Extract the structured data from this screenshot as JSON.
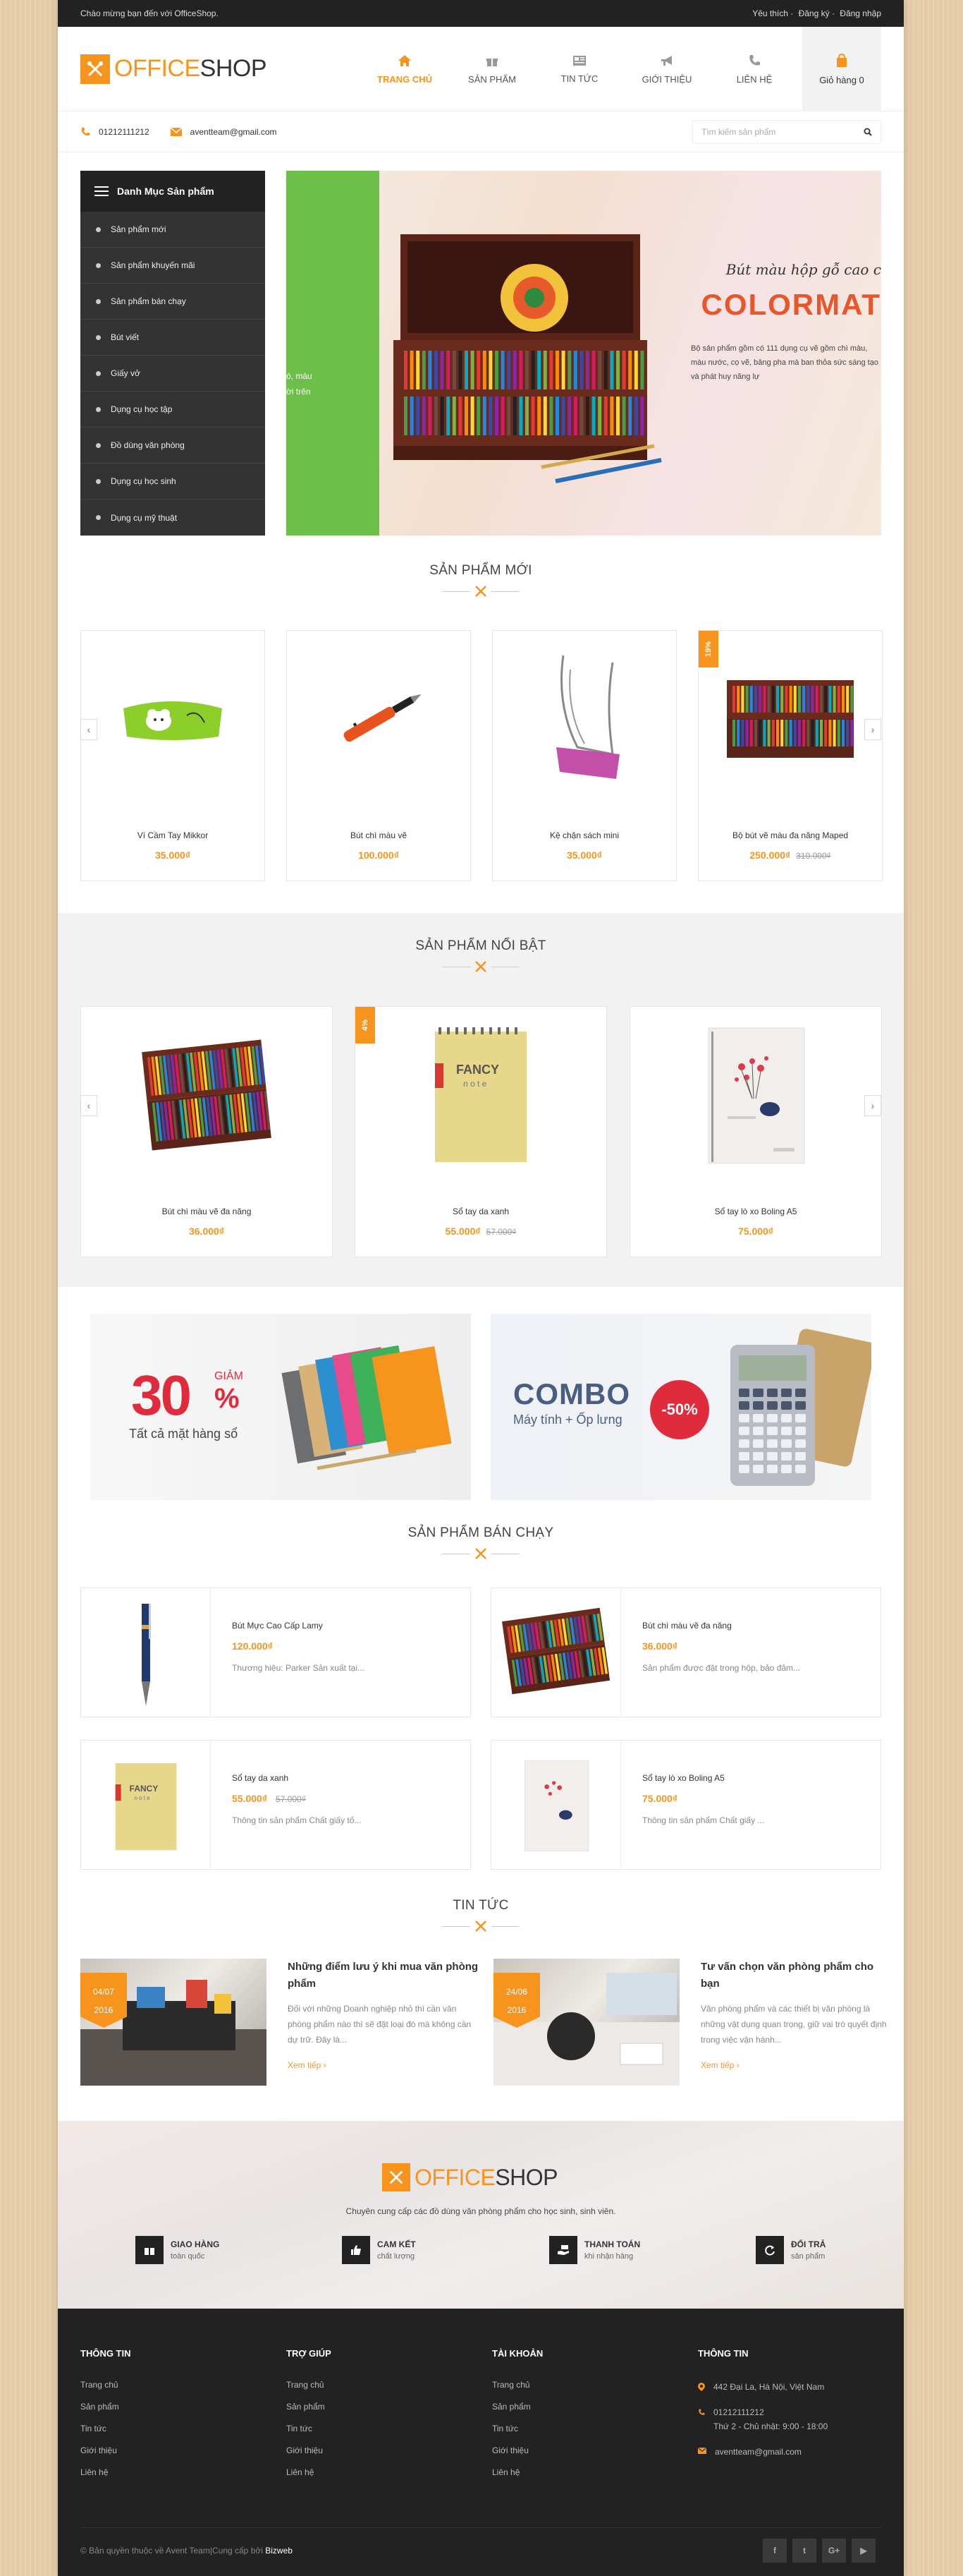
{
  "topbar": {
    "welcome": "Chào mừng bạn đến với OfficeShop.",
    "links": [
      "Yêu thích",
      "Đăng ký",
      "Đăng nhập"
    ]
  },
  "brand": {
    "part1": "OFFICE",
    "part2": "SHOP"
  },
  "nav": {
    "items": [
      {
        "label": "TRANG CHỦ",
        "icon": "home-icon"
      },
      {
        "label": "SẢN PHẨM",
        "icon": "gift-icon"
      },
      {
        "label": "TIN TỨC",
        "icon": "news-icon"
      },
      {
        "label": "GIỚI THIỆU",
        "icon": "megaphone-icon"
      },
      {
        "label": "LIÊN HỆ",
        "icon": "phone-icon"
      }
    ],
    "cart_label": "Giỏ hàng 0"
  },
  "contact": {
    "phone": "01212111212",
    "email": "aventteam@gmail.com",
    "search_placeholder": "Tìm kiếm sản phẩm"
  },
  "categories": {
    "title": "Danh Mục Sản phẩm",
    "items": [
      "Sản phẩm mới",
      "Sản phẩm khuyến mãi",
      "Sản phẩm bán chạy",
      "Bút viết",
      "Giấy vở",
      "Dụng cụ học tập",
      "Đồ dùng văn phòng",
      "Dụng cụ học sinh",
      "Dụng cụ mỹ thuật"
    ]
  },
  "banner": {
    "left_text": [
      "ó, màu",
      "ời trên"
    ],
    "title": "Bút màu hộp gỗ cao c",
    "brand": "COLORMAT",
    "desc": "Bộ sản phẩm gồm có 111 dụng cụ vẽ gồm chì màu, màu nước, cọ vẽ, bảng pha mà ban thỏa sức sáng tạo và phát huy năng lự"
  },
  "new_products": {
    "title": "SẢN PHẨM MỚI",
    "items": [
      {
        "name": "Ví Cầm Tay Mikkor",
        "price": "35.000₫",
        "old": "",
        "sale": ""
      },
      {
        "name": "Bút chì màu vẽ",
        "price": "100.000₫",
        "old": "",
        "sale": ""
      },
      {
        "name": "Kệ chặn sách mini",
        "price": "35.000₫",
        "old": "",
        "sale": ""
      },
      {
        "name": "Bộ bút vẽ màu đa năng Maped",
        "price": "250.000₫",
        "old": "310.000₫",
        "sale": "19%"
      }
    ]
  },
  "featured": {
    "title": "SẢN PHẨM NỔI BẬT",
    "items": [
      {
        "name": "Bút chì màu vẽ đa năng",
        "price": "36.000₫",
        "old": "",
        "sale": ""
      },
      {
        "name": "Sổ tay da xanh",
        "price": "55.000₫",
        "old": "57.000₫",
        "sale": "4%"
      },
      {
        "name": "Sổ tay lò xo Boling A5",
        "price": "75.000₫",
        "old": "",
        "sale": ""
      }
    ]
  },
  "promos": {
    "p1": {
      "big": "30",
      "pct": "%",
      "giam": "GIẢM",
      "sub": "Tất cả mặt hàng sổ"
    },
    "p2": {
      "combo": "COMBO",
      "sub": "Máy tính + Ốp lưng",
      "badge": "-50%"
    }
  },
  "bestsellers": {
    "title": "SẢN PHẨM BÁN CHẠY",
    "items": [
      {
        "name": "Bút Mực Cao Cấp Lamy",
        "price": "120.000₫",
        "old": "",
        "desc": "Thương hiệu: Parker Sản xuất tại..."
      },
      {
        "name": "Bút chì màu vẽ đa năng",
        "price": "36.000₫",
        "old": "",
        "desc": "Sản phẩm được đặt trong hộp, bảo đảm..."
      },
      {
        "name": "Sổ tay da xanh",
        "price": "55.000₫",
        "old": "57.000₫",
        "desc": "Thông tin sản phẩm Chất giấy tố..."
      },
      {
        "name": "Sổ tay lò xo Boling A5",
        "price": "75.000₫",
        "old": "",
        "desc": "Thông tin sản phẩm Chất giấy ..."
      }
    ]
  },
  "news": {
    "title": "TIN TỨC",
    "items": [
      {
        "day": "04/07",
        "year": "2016",
        "title": "Những điểm lưu ý khi mua văn phòng phẩm",
        "desc": "Đối với những Doanh nghiệp nhỏ thì cần văn phòng phẩm nào thì sẽ đặt loại đó mà không cần dự trữ. Đây là...",
        "more": "Xem tiếp ›"
      },
      {
        "day": "24/06",
        "year": "2016",
        "title": "Tư vấn chọn văn phòng phẩm cho bạn",
        "desc": "Văn phòng phẩm và các thiết bị văn phòng là những vật dụng quan trọng, giữ vai trò quyết định trong việc vận hành...",
        "more": "Xem tiếp ›"
      }
    ]
  },
  "brandband": {
    "slogan": "Chuyên cung cấp các đồ dùng văn phòng phẩm cho học sinh, sinh viên.",
    "features": [
      {
        "title": "GIAO HÀNG",
        "sub": "toàn quốc",
        "icon": "gift-box-icon"
      },
      {
        "title": "CAM KẾT",
        "sub": "chất lượng",
        "icon": "thumbs-up-icon"
      },
      {
        "title": "THANH TOÁN",
        "sub": "khi nhận hàng",
        "icon": "hand-money-icon"
      },
      {
        "title": "ĐỔI TRẢ",
        "sub": "sản phẩm",
        "icon": "refresh-icon"
      }
    ]
  },
  "footer": {
    "cols": [
      {
        "title": "THÔNG TIN",
        "links": [
          "Trang chủ",
          "Sản phẩm",
          "Tin tức",
          "Giới thiệu",
          "Liên hệ"
        ]
      },
      {
        "title": "TRỢ GIÚP",
        "links": [
          "Trang chủ",
          "Sản phẩm",
          "Tin tức",
          "Giới thiệu",
          "Liên hệ"
        ]
      },
      {
        "title": "TÀI KHOẢN",
        "links": [
          "Trang chủ",
          "Sản phẩm",
          "Tin tức",
          "Giới thiệu",
          "Liên hệ"
        ]
      }
    ],
    "info_title": "THÔNG TIN",
    "address": "442 Đại La, Hà Nội, Việt Nam",
    "phone": "01212111212",
    "hours": "Thứ 2 - Chủ nhật: 9:00 - 18:00",
    "email": "aventteam@gmail.com",
    "copyright": "© Bản quyền thuộc về Avent Team",
    "provider_prefix": "Cung cấp bởi",
    "provider": "Bizweb",
    "social": [
      "f",
      "t",
      "G+",
      "▶"
    ]
  },
  "colors": {
    "accent": "#f7941d",
    "dark": "#222222",
    "sale": "#e02b3c"
  }
}
